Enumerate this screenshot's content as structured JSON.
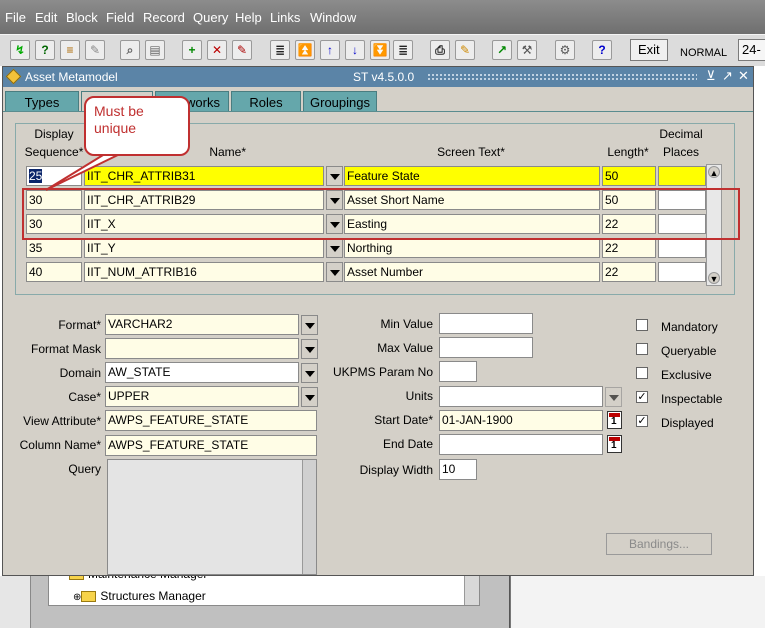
{
  "menu": [
    "File",
    "Edit",
    "Block",
    "Field",
    "Record",
    "Query",
    "Help",
    "Links",
    "Window"
  ],
  "toolbar": {
    "exit_label": "Exit",
    "mode": "NORMAL",
    "date_partial": "24-"
  },
  "window": {
    "title": "Asset Metamodel",
    "version": "ST v4.5.0.0",
    "controls": [
      "⊻",
      "↗",
      "✕"
    ]
  },
  "tabs": [
    "Types",
    "",
    "works",
    "Roles",
    "Groupings"
  ],
  "grid": {
    "headers": {
      "display_sequence_1": "Display",
      "display_sequence_2": "Sequence*",
      "name": "Name*",
      "screen_text": "Screen Text*",
      "length": "Length*",
      "decimal_1": "Decimal",
      "decimal_2": "Places"
    },
    "rows": [
      {
        "seq": "25",
        "name": "IIT_CHR_ATTRIB31",
        "text": "Feature State",
        "length": "50",
        "decimal": ""
      },
      {
        "seq": "30",
        "name": "IIT_CHR_ATTRIB29",
        "text": "Asset Short Name",
        "length": "50",
        "decimal": ""
      },
      {
        "seq": "30",
        "name": "IIT_X",
        "text": "Easting",
        "length": "22",
        "decimal": ""
      },
      {
        "seq": "35",
        "name": "IIT_Y",
        "text": "Northing",
        "length": "22",
        "decimal": ""
      },
      {
        "seq": "40",
        "name": "IIT_NUM_ATTRIB16",
        "text": "Asset Number",
        "length": "22",
        "decimal": ""
      }
    ]
  },
  "form": {
    "format_label": "Format*",
    "format_value": "VARCHAR2",
    "format_mask_label": "Format Mask",
    "format_mask_value": "",
    "domain_label": "Domain",
    "domain_value": "AW_STATE",
    "case_label": "Case*",
    "case_value": "UPPER",
    "view_attribute_label": "View Attribute*",
    "view_attribute_value": "AWPS_FEATURE_STATE",
    "column_name_label": "Column Name*",
    "column_name_value": "AWPS_FEATURE_STATE",
    "query_label": "Query",
    "min_value_label": "Min Value",
    "min_value": "",
    "max_value_label": "Max Value",
    "max_value": "",
    "ukpms_label": "UKPMS Param No",
    "ukpms_value": "",
    "units_label": "Units",
    "units_value": "",
    "start_date_label": "Start Date*",
    "start_date_value": "01-JAN-1900",
    "end_date_label": "End Date",
    "end_date_value": "",
    "display_width_label": "Display Width",
    "display_width_value": "10"
  },
  "checkboxes": [
    {
      "label": "Mandatory",
      "checked": false
    },
    {
      "label": "Queryable",
      "checked": false
    },
    {
      "label": "Exclusive",
      "checked": false
    },
    {
      "label": "Inspectable",
      "checked": true
    },
    {
      "label": "Displayed",
      "checked": true
    }
  ],
  "bandings_label": "Bandings...",
  "calendar_glyph": "1",
  "annotation": {
    "callout_text": "Must be unique",
    "color": "#c03030"
  },
  "background_tree": {
    "items": [
      "Maintenance Manager",
      "Structures Manager"
    ]
  }
}
